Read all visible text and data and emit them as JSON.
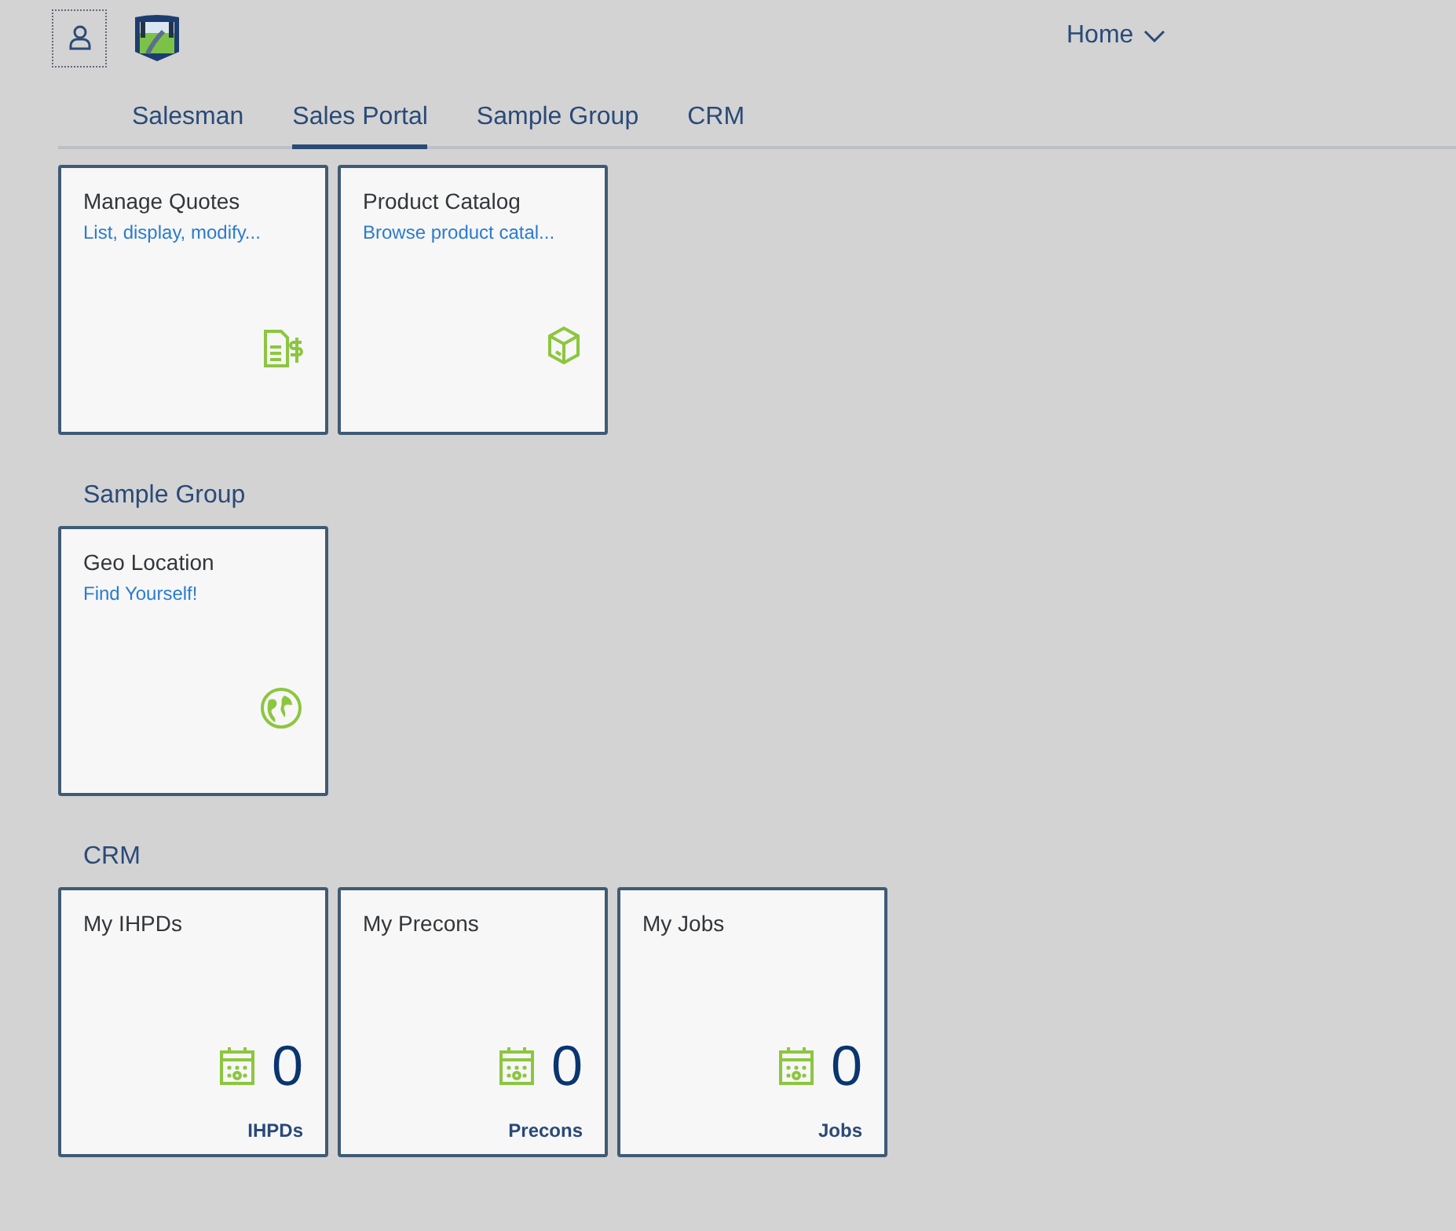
{
  "header": {
    "home_menu": "Home"
  },
  "tabs": [
    {
      "label": "Salesman",
      "selected": false
    },
    {
      "label": "Sales Portal",
      "selected": true
    },
    {
      "label": "Sample Group",
      "selected": false
    },
    {
      "label": "CRM",
      "selected": false
    }
  ],
  "groups": [
    {
      "tiles": [
        {
          "kind": "launch",
          "title": "Manage Quotes",
          "subtitle": "List, display, modify..."
        },
        {
          "kind": "launch",
          "title": "Product Catalog",
          "subtitle": "Browse product catal..."
        }
      ]
    },
    {
      "title": "Sample Group",
      "tiles": [
        {
          "kind": "launch",
          "title": "Geo Location",
          "subtitle": "Find Yourself!"
        }
      ]
    },
    {
      "title": "CRM",
      "tiles": [
        {
          "kind": "kpi",
          "title": "My IHPDs",
          "value": "0",
          "unit": "IHPDs"
        },
        {
          "kind": "kpi",
          "title": "My Precons",
          "value": "0",
          "unit": "Precons"
        },
        {
          "kind": "kpi",
          "title": "My Jobs",
          "value": "0",
          "unit": "Jobs"
        }
      ]
    }
  ]
}
